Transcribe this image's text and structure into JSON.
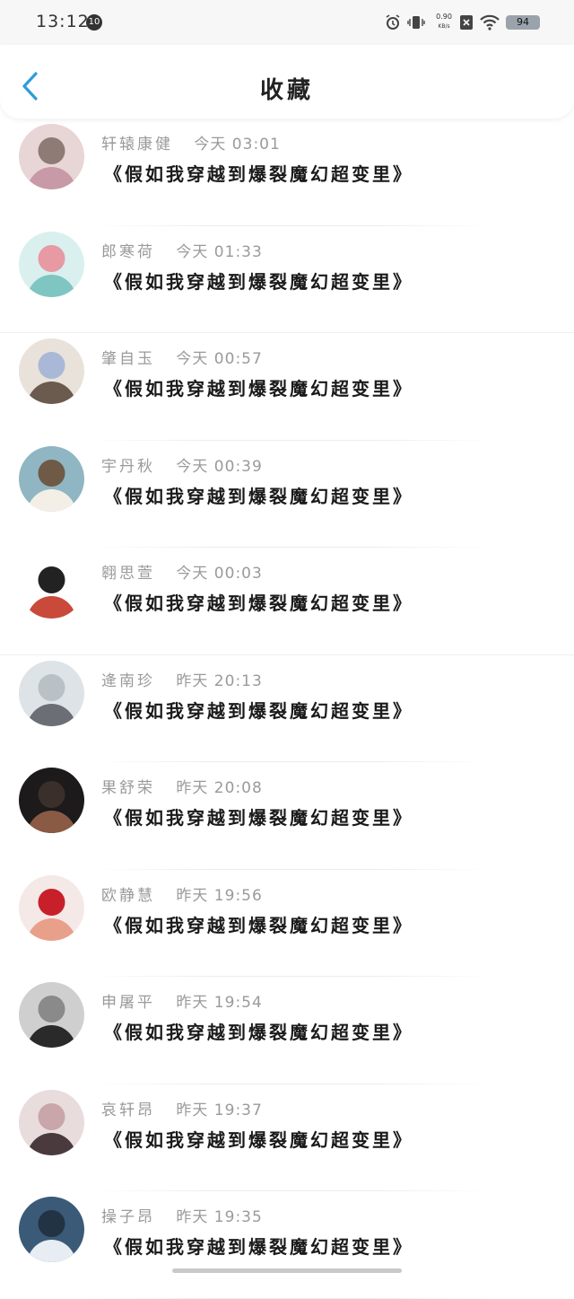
{
  "status": {
    "time": "13:12",
    "notification_count": "10",
    "net_speed_value": "0.90",
    "net_speed_unit": "KB/s",
    "battery": "94"
  },
  "header": {
    "title": "收藏",
    "back_icon": "chevron-left-icon",
    "accent_color": "#2d9cdb"
  },
  "items": [
    {
      "name": "轩辕康健",
      "time": "今天 03:01",
      "title": "《假如我穿越到爆裂魔幻超变里》",
      "avatar_colors": [
        "#e8d6d6",
        "#c89aa8",
        "#8e7b76"
      ]
    },
    {
      "name": "郎寒荷",
      "time": "今天 01:33",
      "title": "《假如我穿越到爆裂魔幻超变里》",
      "avatar_colors": [
        "#d9f0ee",
        "#7fc6c2",
        "#e79aa3"
      ]
    },
    {
      "name": "肇自玉",
      "time": "今天 00:57",
      "title": "《假如我穿越到爆裂魔幻超变里》",
      "avatar_colors": [
        "#e8e2da",
        "#6b5a4e",
        "#a9b8d6"
      ]
    },
    {
      "name": "宇丹秋",
      "time": "今天 00:39",
      "title": "《假如我穿越到爆裂魔幻超变里》",
      "avatar_colors": [
        "#8fb6c2",
        "#f3efe7",
        "#6f5a48"
      ]
    },
    {
      "name": "翱思萱",
      "time": "今天 00:03",
      "title": "《假如我穿越到爆裂魔幻超变里》",
      "avatar_colors": [
        "#ffffff",
        "#c94a3b",
        "#222222"
      ]
    },
    {
      "name": "逄南珍",
      "time": "昨天 20:13",
      "title": "《假如我穿越到爆裂魔幻超变里》",
      "avatar_colors": [
        "#dde3e6",
        "#6b6f75",
        "#b9c1c6"
      ]
    },
    {
      "name": "果舒荣",
      "time": "昨天 20:08",
      "title": "《假如我穿越到爆裂魔幻超变里》",
      "avatar_colors": [
        "#1c1a1a",
        "#8a5a45",
        "#3a2f2b"
      ]
    },
    {
      "name": "欧静慧",
      "time": "昨天 19:56",
      "title": "《假如我穿越到爆裂魔幻超变里》",
      "avatar_colors": [
        "#f4e9e6",
        "#e8a08a",
        "#c8202a"
      ]
    },
    {
      "name": "申屠平",
      "time": "昨天 19:54",
      "title": "《假如我穿越到爆裂魔幻超变里》",
      "avatar_colors": [
        "#cfcfcf",
        "#2a2a2a",
        "#8a8a8a"
      ]
    },
    {
      "name": "哀轩昂",
      "time": "昨天 19:37",
      "title": "《假如我穿越到爆裂魔幻超变里》",
      "avatar_colors": [
        "#e9dcdc",
        "#4a3a3d",
        "#c9a6aa"
      ]
    },
    {
      "name": "操子昂",
      "time": "昨天 19:35",
      "title": "《假如我穿越到爆裂魔幻超变里》",
      "avatar_colors": [
        "#3a5a78",
        "#e7edf2",
        "#223344"
      ]
    }
  ]
}
